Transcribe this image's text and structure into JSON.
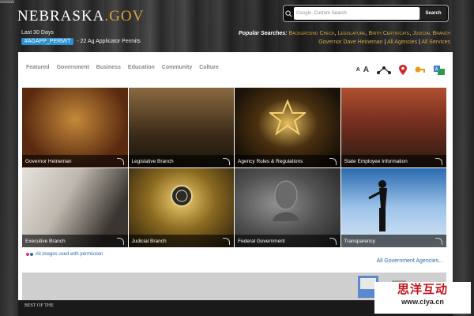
{
  "header": {
    "logo_main": "NEBRASKA",
    "logo_suffix": ".GOV",
    "top_corner": "ssssss",
    "last30": "Last 30 Days",
    "permit_tag": "#AGAPP_PERMIT",
    "permit_text": "- 22 Ag Applicator Permits"
  },
  "search": {
    "google_label": "Google",
    "placeholder": "Custom Search",
    "button_label": "Search"
  },
  "popular": {
    "label": "Popular Searches:",
    "links": [
      "Background Check",
      "Legislature",
      "Birth Certificate",
      "Judicial Branch"
    ],
    "links2": [
      "Governor Dave Heineman",
      "All Agencies",
      "All Services"
    ]
  },
  "nav": [
    "Featured",
    "Government",
    "Business",
    "Education",
    "Community",
    "Culture"
  ],
  "tools": {
    "font_small": "A",
    "font_large": "A"
  },
  "tiles": [
    "Governor Heineman",
    "Legislative Branch",
    "Agency Rules & Regulations",
    "State Employee Information",
    "Executive Branch",
    "Judicial Branch",
    "Federal Government",
    "Transparency"
  ],
  "permission_text": "All images used with permission",
  "all_agencies": "All Government Agencies...",
  "bottom": {
    "best_of": "BEST OF THE"
  },
  "watermark": {
    "main": "思洋互动",
    "url": "www.ciya.cn"
  }
}
